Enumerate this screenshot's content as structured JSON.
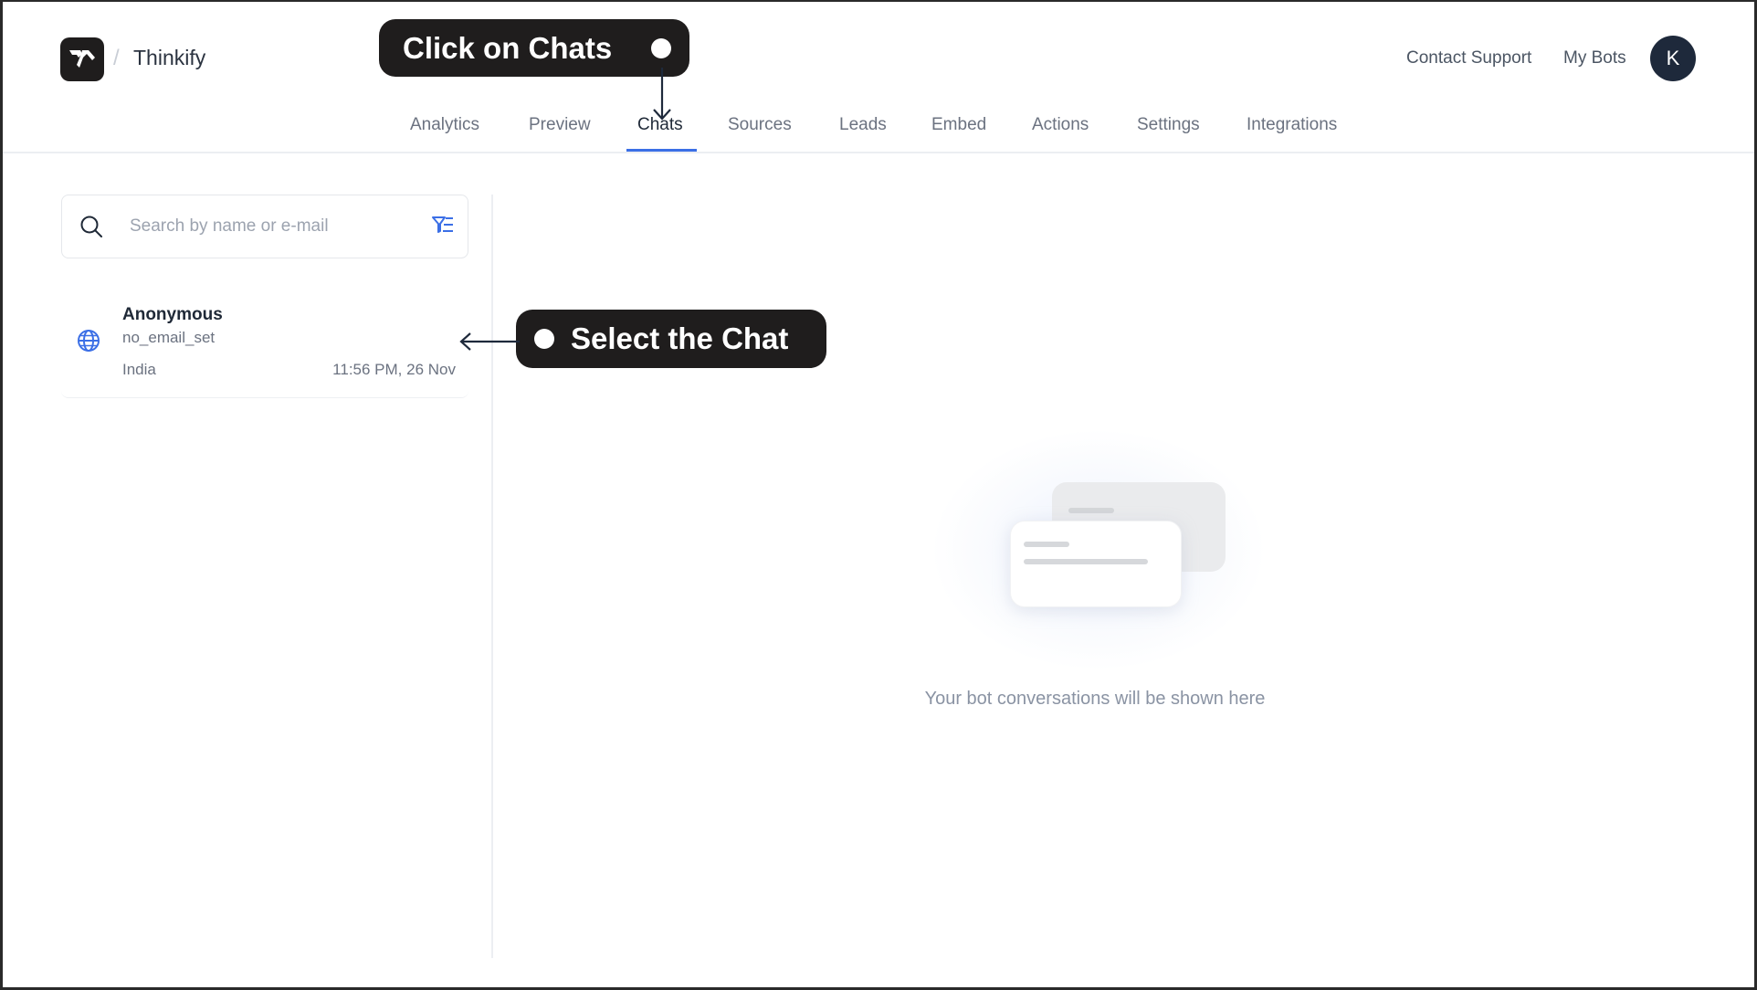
{
  "header": {
    "logo": "thinkify-logo-icon",
    "separator": "/",
    "brand": "Thinkify",
    "links": [
      {
        "label": "Contact Support"
      },
      {
        "label": "My Bots"
      }
    ],
    "avatar_initial": "K"
  },
  "tabs": [
    {
      "label": "Analytics",
      "active": false
    },
    {
      "label": "Preview",
      "active": false
    },
    {
      "label": "Chats",
      "active": true
    },
    {
      "label": "Sources",
      "active": false
    },
    {
      "label": "Leads",
      "active": false
    },
    {
      "label": "Embed",
      "active": false
    },
    {
      "label": "Actions",
      "active": false
    },
    {
      "label": "Settings",
      "active": false
    },
    {
      "label": "Integrations",
      "active": false
    }
  ],
  "search": {
    "placeholder": "Search by name or e-mail",
    "value": "",
    "icon": "search-icon",
    "filter_icon": "filter-list-icon"
  },
  "chats": [
    {
      "name": "Anonymous",
      "email": "no_email_set",
      "country": "India",
      "time": "11:56 PM, 26 Nov",
      "icon": "globe-icon"
    }
  ],
  "empty_state": {
    "message": "Your bot conversations will be shown here"
  },
  "annotations": {
    "click_chats": "Click on Chats",
    "select_chat": "Select the Chat"
  },
  "colors": {
    "accent": "#3b6fe6",
    "callout_bg": "#1f1d1d",
    "avatar_bg": "#1e293b"
  }
}
